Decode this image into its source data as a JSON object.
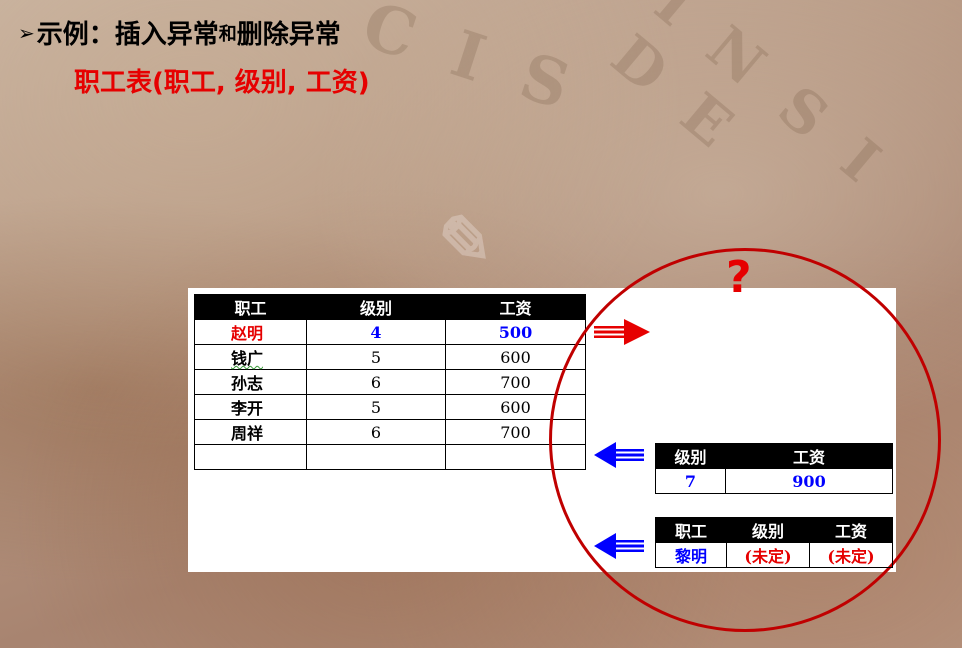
{
  "title": {
    "bullet": "➢",
    "part1": "示例：插入异常",
    "part2": "和",
    "part3": "删除异常"
  },
  "subtitle": "职工表(职工, 级别, 工资)",
  "main_table": {
    "headers": [
      "职工",
      "级别",
      "工资"
    ],
    "rows": [
      [
        "赵明",
        "4",
        "500"
      ],
      [
        "钱广",
        "5",
        "600"
      ],
      [
        "孙志",
        "6",
        "700"
      ],
      [
        "李开",
        "5",
        "600"
      ],
      [
        "周祥",
        "6",
        "700"
      ],
      [
        "",
        "",
        ""
      ]
    ]
  },
  "grade_table": {
    "headers": [
      "级别",
      "工资"
    ],
    "row": [
      "7",
      "900"
    ]
  },
  "employee_table": {
    "headers": [
      "职工",
      "级别",
      "工资"
    ],
    "row": [
      "黎明",
      "(未定)",
      "(未定)"
    ]
  },
  "question_mark": "?",
  "watermark": {
    "line1": "C I S",
    "line2": "I N S I D E"
  },
  "colors": {
    "accent_red": "#e60000",
    "accent_blue": "#0000ff",
    "circle": "#c00000"
  }
}
